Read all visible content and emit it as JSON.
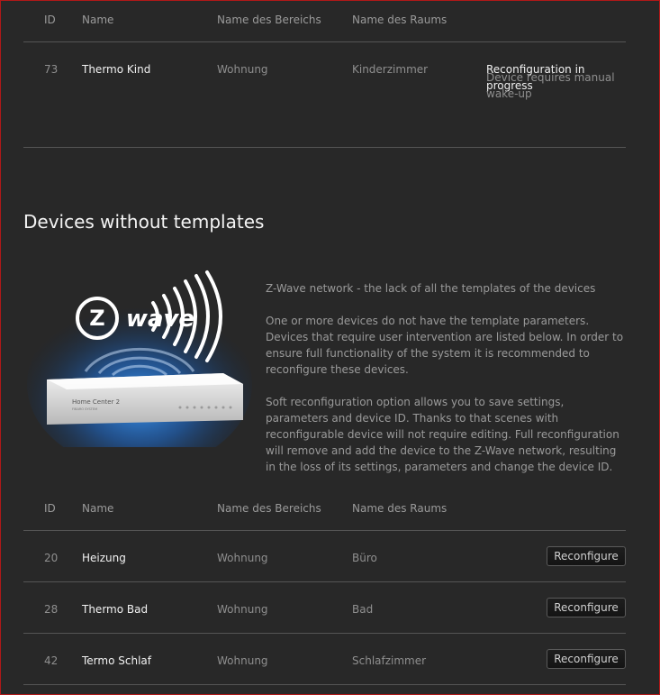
{
  "table1": {
    "headers": {
      "id": "ID",
      "name": "Name",
      "area": "Name des Bereichs",
      "room": "Name des Raums"
    },
    "rows": [
      {
        "id": "73",
        "name": "Thermo Kind",
        "area": "Wohnung",
        "room": "Kinderzimmer",
        "status_line1": "Reconfiguration in progress",
        "status_line2": "Device requires manual wake-up"
      }
    ]
  },
  "section": {
    "title": "Devices without templates",
    "hero": {
      "logo_text": "wave",
      "logo_letter": "Z",
      "device_brand": "Home Center 2",
      "device_sub": "FIBARO SYSTEM"
    },
    "paragraphs": [
      "Z-Wave network - the lack of all the templates of the devices",
      "One or more devices do not have the template parameters. Devices that require user intervention are listed below. In order to ensure full functionality of the system it is recommended to reconfigure these devices.",
      "Soft reconfiguration option allows you to save settings, parameters and device ID. Thanks to that scenes with reconfigurable device will not require editing. Full reconfiguration will remove and add the device to the Z-Wave network, resulting in the loss of its settings, parameters and change the device ID."
    ]
  },
  "table2": {
    "headers": {
      "id": "ID",
      "name": "Name",
      "area": "Name des Bereichs",
      "room": "Name des Raums"
    },
    "button_label": "Reconfigure",
    "rows": [
      {
        "id": "20",
        "name": "Heizung",
        "area": "Wohnung",
        "room": "Büro"
      },
      {
        "id": "28",
        "name": "Thermo Bad",
        "area": "Wohnung",
        "room": "Bad"
      },
      {
        "id": "42",
        "name": "Termo Schlaf",
        "area": "Wohnung",
        "room": "Schlafzimmer"
      }
    ]
  },
  "colors": {
    "background": "#282828",
    "accent_glow": "#1e6fd6",
    "text": "#f2f2f2",
    "muted": "#8f8f8f"
  }
}
